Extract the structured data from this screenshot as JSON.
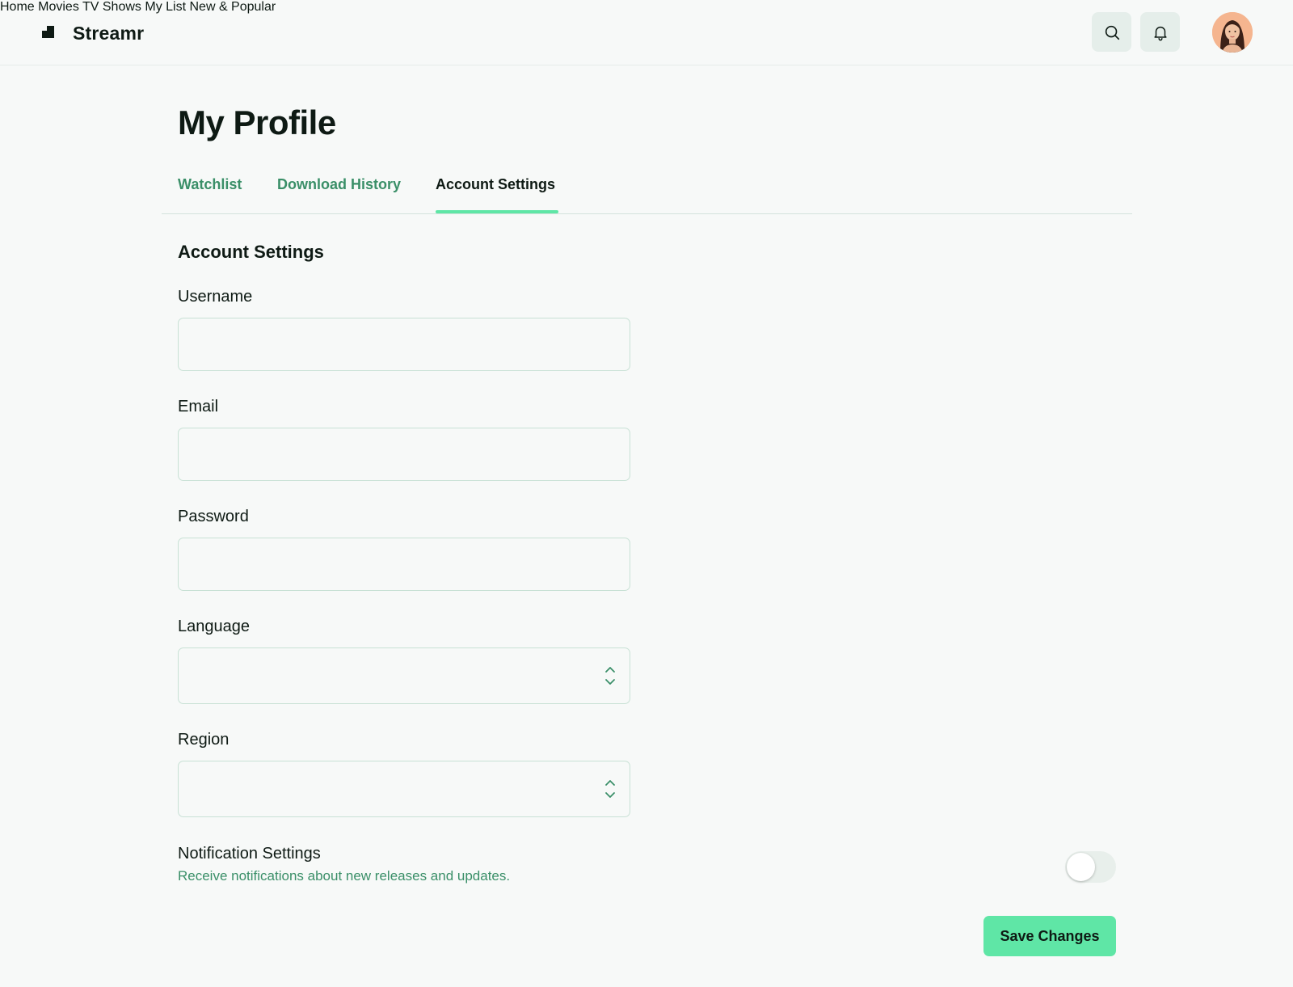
{
  "header": {
    "brand": "Streamr",
    "nav": [
      "Home",
      "Movies",
      "TV Shows",
      "My List",
      "New & Popular"
    ],
    "search_icon": "search-icon",
    "bell_icon": "bell-icon"
  },
  "page": {
    "title": "My Profile"
  },
  "tabs": [
    {
      "label": "Watchlist",
      "active": false
    },
    {
      "label": "Download History",
      "active": false
    },
    {
      "label": "Account Settings",
      "active": true
    }
  ],
  "form": {
    "section_title": "Account Settings",
    "username": {
      "label": "Username",
      "value": ""
    },
    "email": {
      "label": "Email",
      "value": ""
    },
    "password": {
      "label": "Password",
      "value": ""
    },
    "language": {
      "label": "Language",
      "value": ""
    },
    "region": {
      "label": "Region",
      "value": ""
    },
    "notifications": {
      "title": "Notification Settings",
      "description": "Receive notifications about new releases and updates.",
      "enabled": false
    },
    "save_label": "Save Changes"
  },
  "colors": {
    "accent": "#5fe6a6",
    "link_green": "#3a8f68",
    "background": "#f7f9f8",
    "text": "#0e1a14"
  }
}
